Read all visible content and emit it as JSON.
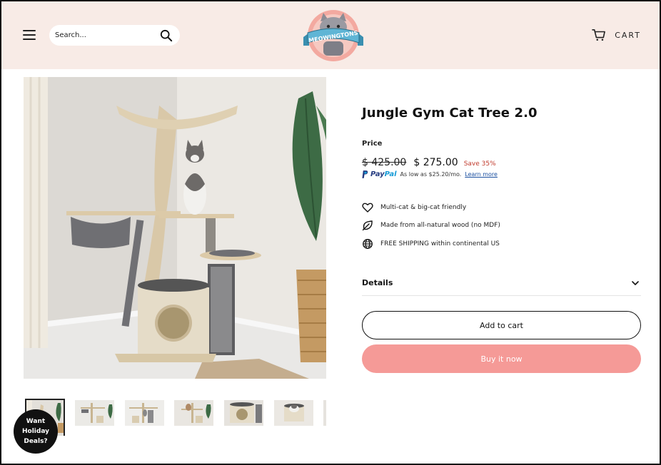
{
  "header": {
    "search": {
      "placeholder": "Search..."
    },
    "logo_text": "MEOWINGTONS",
    "cart_label": "CART"
  },
  "product": {
    "title": "Jungle Gym Cat Tree 2.0",
    "price_label": "Price",
    "old_price": "$ 425.00",
    "new_price": "$ 275.00",
    "save_text": "Save 35%",
    "paypal": {
      "brand_a": "Pay",
      "brand_b": "Pal",
      "text": "As low as $25.20/mo.",
      "link": "Learn more"
    },
    "features": [
      {
        "icon": "heart-icon",
        "text": "Multi-cat & big-cat friendly"
      },
      {
        "icon": "leaf-icon",
        "text": "Made from all-natural wood (no MDF)"
      },
      {
        "icon": "globe-icon",
        "text": "FREE SHIPPING within continental US"
      }
    ],
    "details_label": "Details",
    "add_to_cart": "Add to cart",
    "buy_now": "Buy it now"
  },
  "deals_badge": {
    "line1": "Want",
    "line2": "Holiday",
    "line3": "Deals?"
  },
  "colors": {
    "header_bg": "#f8ebe6",
    "buy_button": "#f59a97",
    "save_text": "#c0392b",
    "paypal_blue": "#253b80",
    "paypal_light": "#179bd7"
  }
}
